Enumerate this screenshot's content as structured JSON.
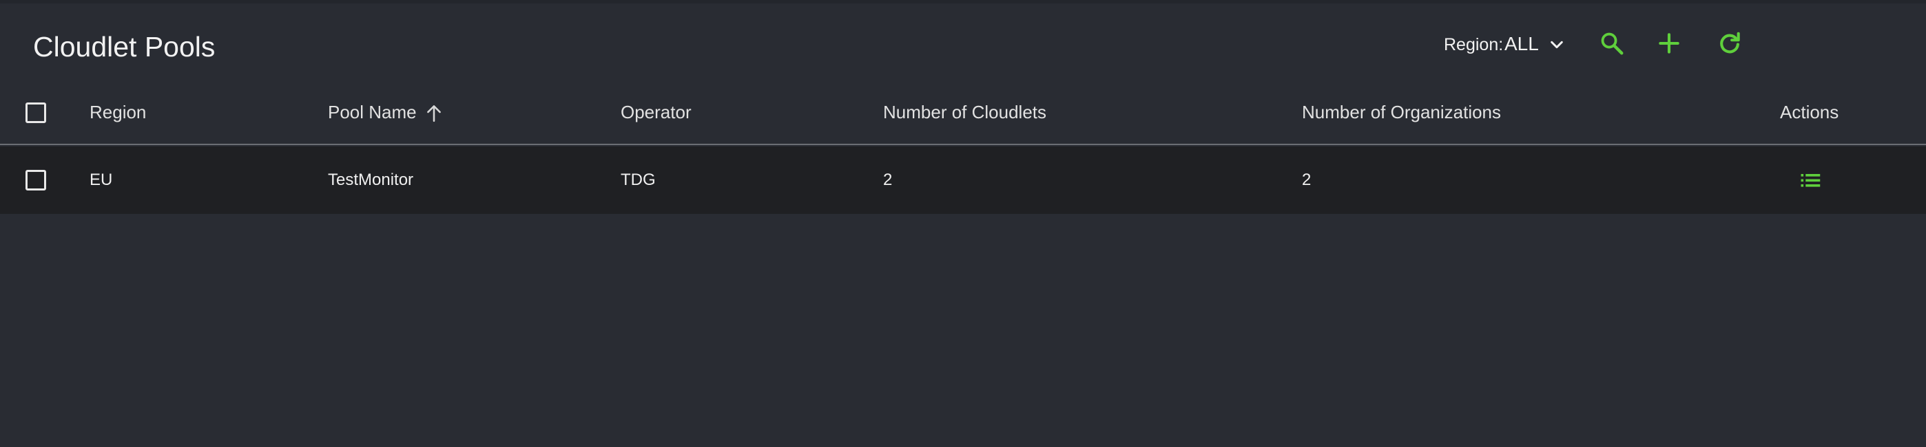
{
  "page": {
    "title": "Cloudlet Pools"
  },
  "toolbar": {
    "region_label": "Region:",
    "region_value": "ALL",
    "accent_color": "#5fcf3c"
  },
  "table": {
    "columns": [
      "Region",
      "Pool Name",
      "Operator",
      "Number of Cloudlets",
      "Number of Organizations",
      "Actions"
    ],
    "sort": {
      "column": "Pool Name",
      "direction": "ascending"
    },
    "rows": [
      {
        "region": "EU",
        "pool_name": "TestMonitor",
        "operator": "TDG",
        "cloudlets": "2",
        "organizations": "2",
        "action_icon": "list-icon"
      }
    ]
  }
}
